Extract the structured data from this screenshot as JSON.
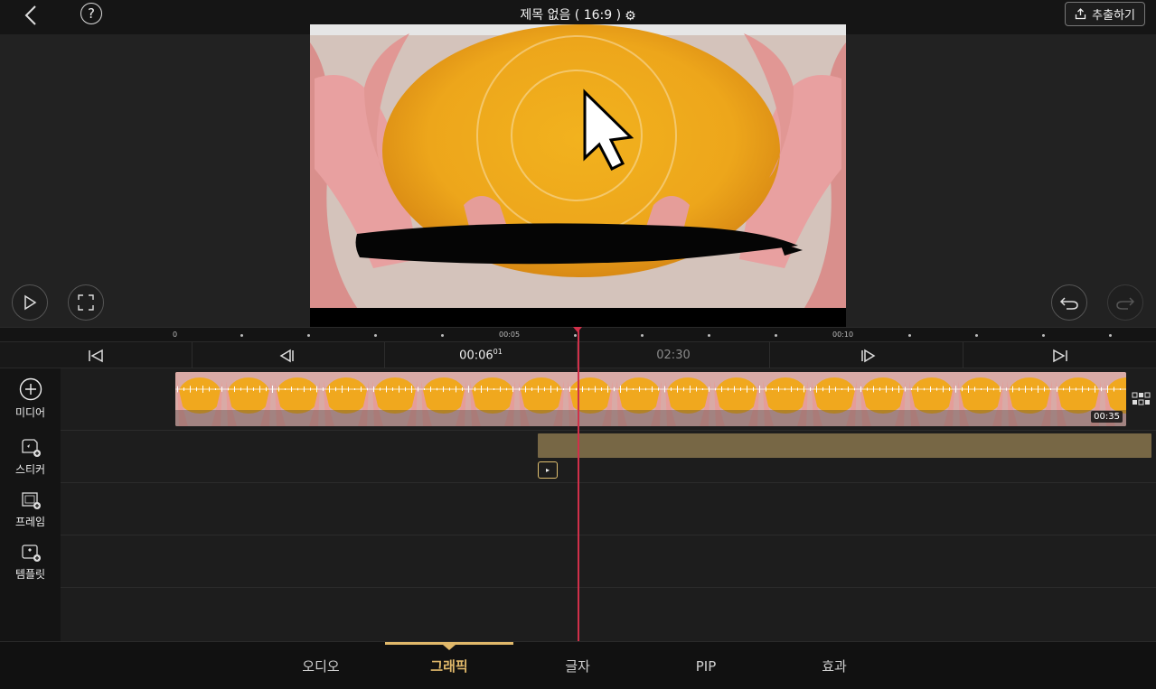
{
  "header": {
    "title": "제목 없음 ( 16:9 )",
    "help": "?",
    "export_label": "추출하기"
  },
  "ruler": {
    "labels": [
      "0",
      "00:05",
      "00:10"
    ]
  },
  "transport": {
    "current_time": "00:06",
    "current_frames": "01",
    "total_time": "02:30"
  },
  "clip": {
    "duration": "00:35"
  },
  "tools": [
    {
      "label": "미디어",
      "icon": "add-circle-icon"
    },
    {
      "label": "스티커",
      "icon": "sticker-icon"
    },
    {
      "label": "프레임",
      "icon": "frame-icon"
    },
    {
      "label": "템플릿",
      "icon": "template-icon"
    }
  ],
  "tabs": [
    {
      "label": "오디오",
      "active": false
    },
    {
      "label": "그래픽",
      "active": true
    },
    {
      "label": "글자",
      "active": false
    },
    {
      "label": "PIP",
      "active": false
    },
    {
      "label": "효과",
      "active": false
    }
  ],
  "colors": {
    "accent": "#e0b86a",
    "playhead": "#d0304a",
    "sticker_track": "#776745"
  }
}
